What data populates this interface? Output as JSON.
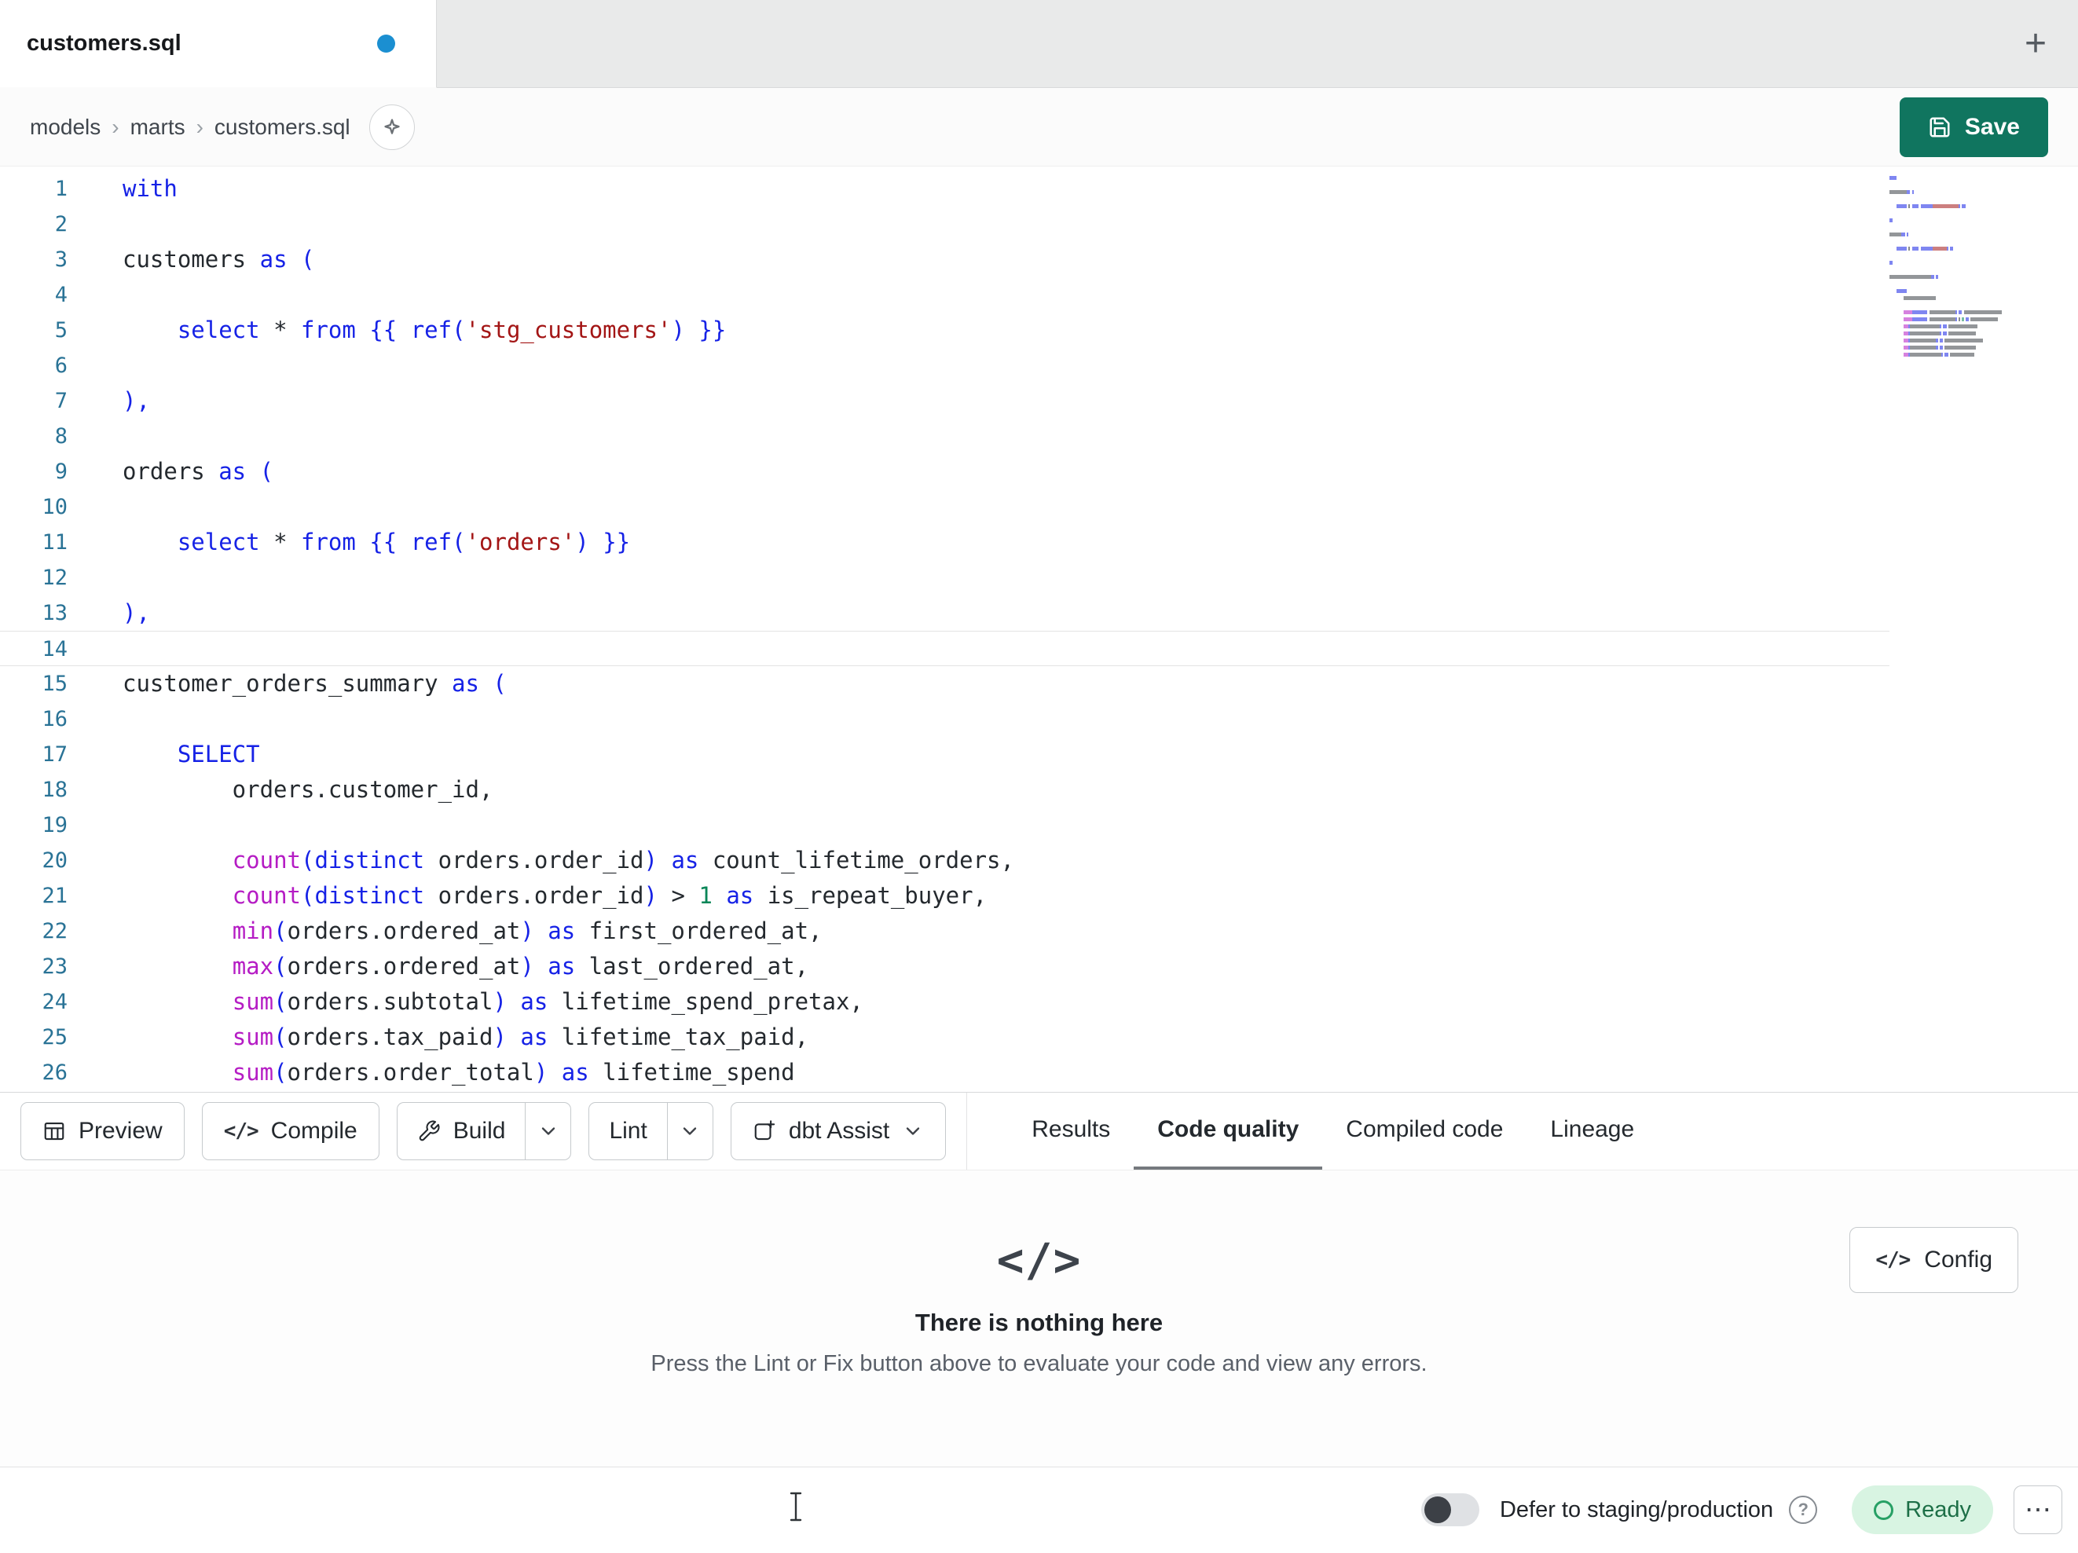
{
  "colors": {
    "save_button": "#10755f",
    "unsaved_dot": "#1b8fd1",
    "ready_bg": "#d8f4e2",
    "ready_text": "#1d6f47",
    "active_tab_underline": "#75797e"
  },
  "tab_bar": {
    "active_tab": "customers.sql"
  },
  "breadcrumb": {
    "items": [
      "models",
      "marts",
      "customers.sql"
    ],
    "separator": "›"
  },
  "save": {
    "label": "Save"
  },
  "editor": {
    "current_line": 14,
    "lines": [
      {
        "n": 1,
        "t": [
          [
            "kw",
            "with"
          ]
        ]
      },
      {
        "n": 2,
        "t": []
      },
      {
        "n": 3,
        "t": [
          [
            "pln",
            "customers "
          ],
          [
            "kw",
            "as"
          ],
          [
            "pun",
            " ("
          ]
        ]
      },
      {
        "n": 4,
        "t": []
      },
      {
        "n": 5,
        "t": [
          [
            "pln",
            "    "
          ],
          [
            "kw",
            "select"
          ],
          [
            "pln",
            " "
          ],
          [
            "op",
            "*"
          ],
          [
            "pln",
            " "
          ],
          [
            "kw",
            "from"
          ],
          [
            "pln",
            " "
          ],
          [
            "pun",
            "{{ "
          ],
          [
            "kw",
            "ref"
          ],
          [
            "pun",
            "("
          ],
          [
            "str",
            "'stg_customers'"
          ],
          [
            "pun",
            ")"
          ],
          [
            "pun",
            " }}"
          ]
        ]
      },
      {
        "n": 6,
        "t": []
      },
      {
        "n": 7,
        "t": [
          [
            "pun",
            "),"
          ]
        ]
      },
      {
        "n": 8,
        "t": []
      },
      {
        "n": 9,
        "t": [
          [
            "pln",
            "orders "
          ],
          [
            "kw",
            "as"
          ],
          [
            "pun",
            " ("
          ]
        ]
      },
      {
        "n": 10,
        "t": []
      },
      {
        "n": 11,
        "t": [
          [
            "pln",
            "    "
          ],
          [
            "kw",
            "select"
          ],
          [
            "pln",
            " "
          ],
          [
            "op",
            "*"
          ],
          [
            "pln",
            " "
          ],
          [
            "kw",
            "from"
          ],
          [
            "pln",
            " "
          ],
          [
            "pun",
            "{{ "
          ],
          [
            "kw",
            "ref"
          ],
          [
            "pun",
            "("
          ],
          [
            "str",
            "'orders'"
          ],
          [
            "pun",
            ")"
          ],
          [
            "pun",
            " }}"
          ]
        ]
      },
      {
        "n": 12,
        "t": []
      },
      {
        "n": 13,
        "t": [
          [
            "pun",
            "),"
          ]
        ]
      },
      {
        "n": 14,
        "t": []
      },
      {
        "n": 15,
        "t": [
          [
            "pln",
            "customer_orders_summary "
          ],
          [
            "kw",
            "as"
          ],
          [
            "pun",
            " ("
          ]
        ]
      },
      {
        "n": 16,
        "t": []
      },
      {
        "n": 17,
        "t": [
          [
            "pln",
            "    "
          ],
          [
            "kw",
            "SELECT"
          ]
        ]
      },
      {
        "n": 18,
        "t": [
          [
            "pln",
            "        orders.customer_id,"
          ]
        ]
      },
      {
        "n": 19,
        "t": []
      },
      {
        "n": 20,
        "t": [
          [
            "pln",
            "        "
          ],
          [
            "fn",
            "count"
          ],
          [
            "pun",
            "("
          ],
          [
            "kw",
            "distinct"
          ],
          [
            "pln",
            " orders.order_id"
          ],
          [
            "pun",
            ")"
          ],
          [
            "pln",
            " "
          ],
          [
            "kw",
            "as"
          ],
          [
            "pln",
            " count_lifetime_orders,"
          ]
        ]
      },
      {
        "n": 21,
        "t": [
          [
            "pln",
            "        "
          ],
          [
            "fn",
            "count"
          ],
          [
            "pun",
            "("
          ],
          [
            "kw",
            "distinct"
          ],
          [
            "pln",
            " orders.order_id"
          ],
          [
            "pun",
            ")"
          ],
          [
            "pln",
            " "
          ],
          [
            "op",
            ">"
          ],
          [
            "pln",
            " "
          ],
          [
            "num",
            "1"
          ],
          [
            "pln",
            " "
          ],
          [
            "kw",
            "as"
          ],
          [
            "pln",
            " is_repeat_buyer,"
          ]
        ]
      },
      {
        "n": 22,
        "t": [
          [
            "pln",
            "        "
          ],
          [
            "fn",
            "min"
          ],
          [
            "pun",
            "("
          ],
          [
            "pln",
            "orders.ordered_at"
          ],
          [
            "pun",
            ")"
          ],
          [
            "pln",
            " "
          ],
          [
            "kw",
            "as"
          ],
          [
            "pln",
            " first_ordered_at,"
          ]
        ]
      },
      {
        "n": 23,
        "t": [
          [
            "pln",
            "        "
          ],
          [
            "fn",
            "max"
          ],
          [
            "pun",
            "("
          ],
          [
            "pln",
            "orders.ordered_at"
          ],
          [
            "pun",
            ")"
          ],
          [
            "pln",
            " "
          ],
          [
            "kw",
            "as"
          ],
          [
            "pln",
            " last_ordered_at,"
          ]
        ]
      },
      {
        "n": 24,
        "t": [
          [
            "pln",
            "        "
          ],
          [
            "fn",
            "sum"
          ],
          [
            "pun",
            "("
          ],
          [
            "pln",
            "orders.subtotal"
          ],
          [
            "pun",
            ")"
          ],
          [
            "pln",
            " "
          ],
          [
            "kw",
            "as"
          ],
          [
            "pln",
            " lifetime_spend_pretax,"
          ]
        ]
      },
      {
        "n": 25,
        "t": [
          [
            "pln",
            "        "
          ],
          [
            "fn",
            "sum"
          ],
          [
            "pun",
            "("
          ],
          [
            "pln",
            "orders.tax_paid"
          ],
          [
            "pun",
            ")"
          ],
          [
            "pln",
            " "
          ],
          [
            "kw",
            "as"
          ],
          [
            "pln",
            " lifetime_tax_paid,"
          ]
        ]
      },
      {
        "n": 26,
        "t": [
          [
            "pln",
            "        "
          ],
          [
            "fn",
            "sum"
          ],
          [
            "pun",
            "("
          ],
          [
            "pln",
            "orders.order_total"
          ],
          [
            "pun",
            ")"
          ],
          [
            "pln",
            " "
          ],
          [
            "kw",
            "as"
          ],
          [
            "pln",
            " lifetime_spend"
          ]
        ]
      }
    ]
  },
  "toolbar": {
    "preview": "Preview",
    "compile": "Compile",
    "build": "Build",
    "lint": "Lint",
    "assist": "dbt Assist"
  },
  "result_tabs": [
    {
      "label": "Results",
      "active": false
    },
    {
      "label": "Code quality",
      "active": true
    },
    {
      "label": "Compiled code",
      "active": false
    },
    {
      "label": "Lineage",
      "active": false
    }
  ],
  "empty_state": {
    "title": "There is nothing here",
    "subtitle": "Press the Lint or Fix button above to evaluate your code and view any errors.",
    "config_label": "Config"
  },
  "status_bar": {
    "defer_label": "Defer to staging/production",
    "ready_label": "Ready"
  },
  "icons": {
    "code_glyph": "</>",
    "plus": "+",
    "ellipsis": "⋯",
    "help": "?"
  }
}
